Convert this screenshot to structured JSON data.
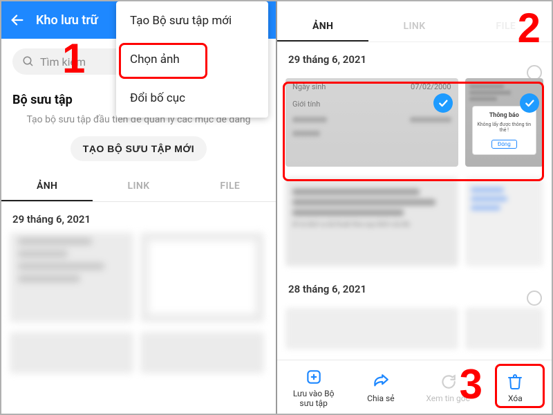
{
  "left": {
    "title": "Kho lưu trữ",
    "dropdown": {
      "create": "Tạo Bộ sưu tập mới",
      "select": "Chọn ảnh",
      "layout": "Đổi bố cục"
    },
    "search_placeholder": "Tìm kiếm",
    "collection_title": "Bộ sưu tập",
    "collection_subtitle": "Tạo bộ sưu tập đầu tiên để quản lý các mục dễ dàng",
    "create_button": "TẠO BỘ SƯU TẬP MỚI",
    "tabs": {
      "photo": "ẢNH",
      "link": "LINK",
      "file": "FILE"
    },
    "date": "29 tháng 6, 2021"
  },
  "right": {
    "tabs": {
      "photo": "ẢNH",
      "link": "LINK",
      "file": "FILE"
    },
    "date1": "29 tháng 6, 2021",
    "date2": "28 tháng 6, 2021",
    "thumb1": {
      "label_birth": "Ngày sinh",
      "value_birth": "07/02/2000",
      "label_gender": "Giới tính",
      "caption": "tế và dịch vụ kỹ thuật theo quy định của Bộ"
    },
    "dialog": {
      "title": "Thông báo",
      "message": "Không lấy được thông tin thẻ !",
      "button": "Đóng"
    },
    "bottom": {
      "save": "Lưu vào Bộ sưu tập",
      "share": "Chia sẻ",
      "view": "Xem tin gốc",
      "delete": "Xóa"
    }
  },
  "annotations": {
    "n1": "1",
    "n2": "2",
    "n3": "3"
  }
}
